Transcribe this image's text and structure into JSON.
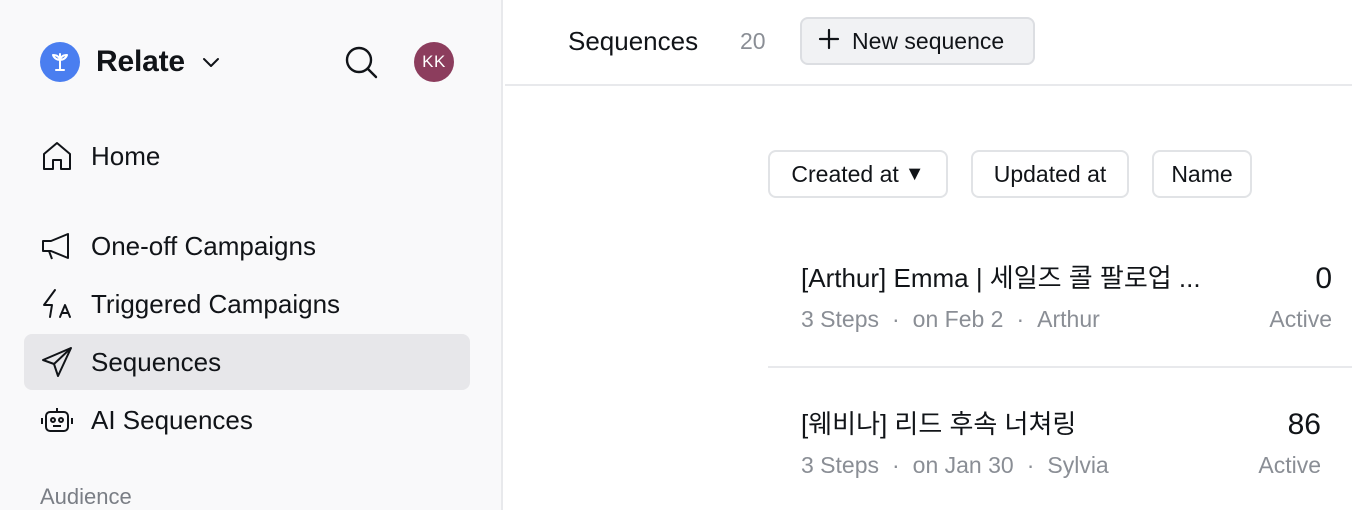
{
  "workspace": {
    "name": "Relate",
    "avatar_initials": "KK",
    "brand_color": "#4a7ef0",
    "avatar_color": "#8c3d5d"
  },
  "sidebar": {
    "items": [
      {
        "label": "Home",
        "icon": "home-icon"
      },
      {
        "label": "One-off Campaigns",
        "icon": "megaphone-icon"
      },
      {
        "label": "Triggered Campaigns",
        "icon": "bolt-icon"
      },
      {
        "label": "Sequences",
        "icon": "paper-plane-icon",
        "active": true
      },
      {
        "label": "AI Sequences",
        "icon": "robot-icon"
      }
    ],
    "section_label": "Audience"
  },
  "header": {
    "title": "Sequences",
    "count": "20",
    "new_button_label": "New sequence"
  },
  "sort": {
    "created": "Created at",
    "created_arrow": "▼",
    "updated": "Updated at",
    "name": "Name"
  },
  "sequences": [
    {
      "title": "[Arthur] Emma | 세일즈 콜 팔로업 ...",
      "steps": "3 Steps",
      "date": "on Feb 2",
      "owner": "Arthur",
      "count": "0",
      "status": "Active"
    },
    {
      "title": "[웨비나] 리드 후속 너쳐링",
      "steps": "3 Steps",
      "date": "on Jan 30",
      "owner": "Sylvia",
      "count": "86",
      "status": "Active"
    }
  ],
  "separator": "·"
}
